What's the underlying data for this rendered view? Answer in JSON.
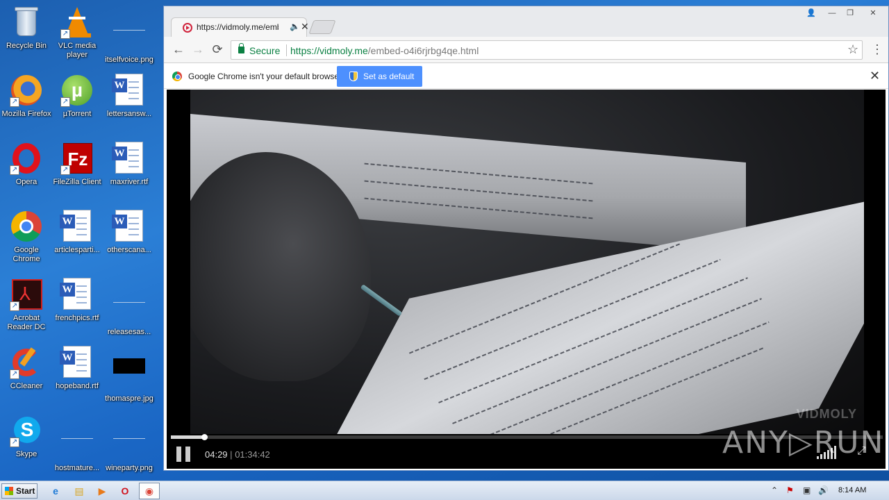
{
  "desktop": {
    "icons": [
      {
        "label": "Recycle Bin",
        "icon": "recycle-bin-icon"
      },
      {
        "label": "VLC media player",
        "icon": "vlc-icon"
      },
      {
        "label": "itselfvoice.png",
        "icon": "image-file-icon"
      },
      {
        "label": "Mozilla Firefox",
        "icon": "firefox-icon"
      },
      {
        "label": "µTorrent",
        "icon": "utorrent-icon"
      },
      {
        "label": "lettersansw...",
        "icon": "word-doc-icon"
      },
      {
        "label": "Opera",
        "icon": "opera-icon"
      },
      {
        "label": "FileZilla Client",
        "icon": "filezilla-icon"
      },
      {
        "label": "maxriver.rtf",
        "icon": "word-doc-icon"
      },
      {
        "label": "Google Chrome",
        "icon": "chrome-icon"
      },
      {
        "label": "articlesparti...",
        "icon": "word-doc-icon"
      },
      {
        "label": "otherscana...",
        "icon": "word-doc-icon"
      },
      {
        "label": "Acrobat Reader DC",
        "icon": "acrobat-icon"
      },
      {
        "label": "frenchpics.rtf",
        "icon": "word-doc-icon"
      },
      {
        "label": "releasesas...",
        "icon": "image-file-icon"
      },
      {
        "label": "CCleaner",
        "icon": "ccleaner-icon"
      },
      {
        "label": "hopeband.rtf",
        "icon": "word-doc-icon"
      },
      {
        "label": "thomaspre.jpg",
        "icon": "image-file-icon"
      },
      {
        "label": "Skype",
        "icon": "skype-icon"
      },
      {
        "label": "hostmature...",
        "icon": "image-file-icon"
      },
      {
        "label": "wineparty.png",
        "icon": "image-file-icon"
      }
    ]
  },
  "browser": {
    "tab": {
      "title": "https://vidmoly.me/emb",
      "close": "✕",
      "audio": "🔈"
    },
    "window_controls": [
      "👤",
      "—",
      "❐",
      "✕"
    ],
    "nav": {
      "back": "←",
      "forward": "→",
      "reload": "⟳"
    },
    "omnibox": {
      "secure_label": "Secure",
      "url_host": "https://vidmoly.me",
      "url_path": "/embed-o4i6rjrbg4qe.html"
    },
    "star": "☆",
    "menu": "⋮",
    "infobar": {
      "message": "Google Chrome isn't your default browser.",
      "button": "Set as default",
      "close": "✕"
    }
  },
  "player": {
    "watermark": "VIDMOLY",
    "current_time": "04:29",
    "separator": "|",
    "duration": "01:34:42",
    "progress_fraction": 0.047,
    "fullscreen": "⤢"
  },
  "overlay": {
    "brand": "ANY▷RUN"
  },
  "taskbar": {
    "start_label": "Start",
    "apps": [
      {
        "icon": "ie-icon",
        "glyph": "e"
      },
      {
        "icon": "explorer-icon",
        "glyph": "▤"
      },
      {
        "icon": "media-player-icon",
        "glyph": "▶"
      },
      {
        "icon": "opera-icon",
        "glyph": "O"
      },
      {
        "icon": "chrome-icon",
        "glyph": "◉"
      }
    ],
    "tray": [
      "⌃",
      "⚑",
      "▣",
      "🔊"
    ],
    "clock": "8:14 AM"
  }
}
